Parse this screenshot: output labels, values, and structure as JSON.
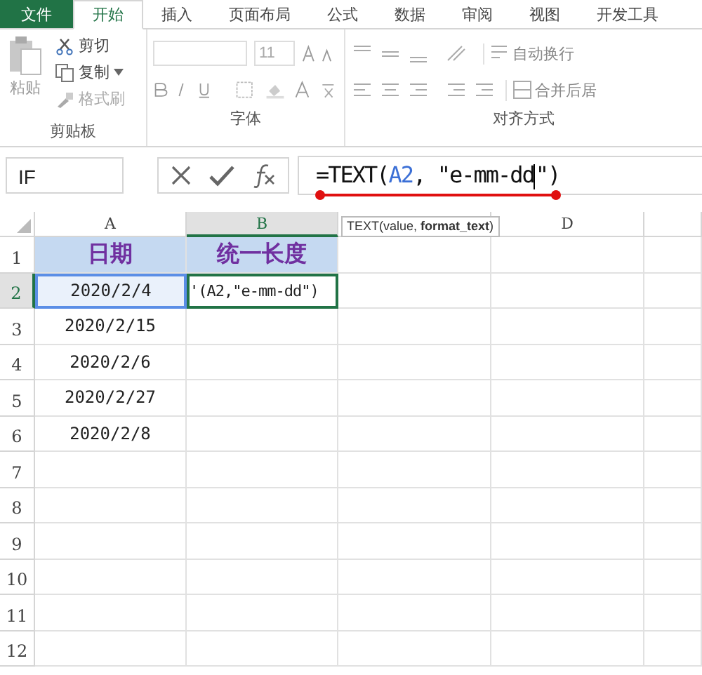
{
  "tabs": [
    {
      "label": "文件",
      "kind": "file",
      "selected": false
    },
    {
      "label": "开始",
      "kind": "tab",
      "selected": true
    },
    {
      "label": "插入",
      "kind": "tab",
      "selected": false
    },
    {
      "label": "页面布局",
      "kind": "tab",
      "selected": false
    },
    {
      "label": "公式",
      "kind": "tab",
      "selected": false
    },
    {
      "label": "数据",
      "kind": "tab",
      "selected": false
    },
    {
      "label": "审阅",
      "kind": "tab",
      "selected": false
    },
    {
      "label": "视图",
      "kind": "tab",
      "selected": false
    },
    {
      "label": "开发工具",
      "kind": "tab",
      "selected": false
    }
  ],
  "clipboard": {
    "paste": "粘贴",
    "cut": "剪切",
    "copy": "复制",
    "format_painter": "格式刷",
    "label": "剪贴板"
  },
  "font": {
    "size": "11",
    "label": "字体"
  },
  "alignment": {
    "wrap": "自动换行",
    "merge": "合并后居",
    "label": "对齐方式"
  },
  "name_box": "IF",
  "formula": [
    {
      "text": "=TEXT(",
      "kind": "plain"
    },
    {
      "text": "A2",
      "kind": "ref"
    },
    {
      "text": ", \"e-mm-dd",
      "kind": "plain"
    },
    {
      "text": "\")",
      "kind": "plain"
    }
  ],
  "tooltip": "TEXT(value, **format_text**)",
  "columns": [
    {
      "label": "A",
      "selected": false
    },
    {
      "label": "B",
      "selected": true
    },
    {
      "selected": false
    },
    {
      "label": "D",
      "selected": false
    },
    {
      "selected": false
    }
  ],
  "rows": [
    {
      "label": "1",
      "selected": false,
      "cells": [
        {
          "text": "日期",
          "kind": "header"
        },
        {
          "text": "统一长度",
          "kind": "header"
        }
      ]
    },
    {
      "label": "2",
      "selected": true,
      "cells": [
        {
          "text": "2020/2/4",
          "kind": "selected"
        },
        {
          "text": "'(A2,\"e-mm-dd\")",
          "kind": "editing"
        }
      ]
    },
    {
      "label": "3",
      "selected": false,
      "cells": [
        {
          "text": "2020/2/15",
          "kind": "value"
        }
      ]
    },
    {
      "label": "4",
      "selected": false,
      "cells": [
        {
          "text": "2020/2/6",
          "kind": "value"
        }
      ]
    },
    {
      "label": "5",
      "selected": false,
      "cells": [
        {
          "text": "2020/2/27",
          "kind": "value"
        }
      ]
    },
    {
      "label": "6",
      "selected": false,
      "cells": [
        {
          "text": "2020/2/8",
          "kind": "value"
        }
      ]
    },
    {
      "label": "7",
      "selected": false,
      "cells": []
    },
    {
      "label": "8",
      "selected": false,
      "cells": []
    },
    {
      "label": "9",
      "selected": false,
      "cells": []
    },
    {
      "label": "10",
      "selected": false,
      "cells": []
    },
    {
      "label": "11",
      "selected": false,
      "cells": []
    },
    {
      "label": "12",
      "selected": false,
      "cells": []
    }
  ]
}
